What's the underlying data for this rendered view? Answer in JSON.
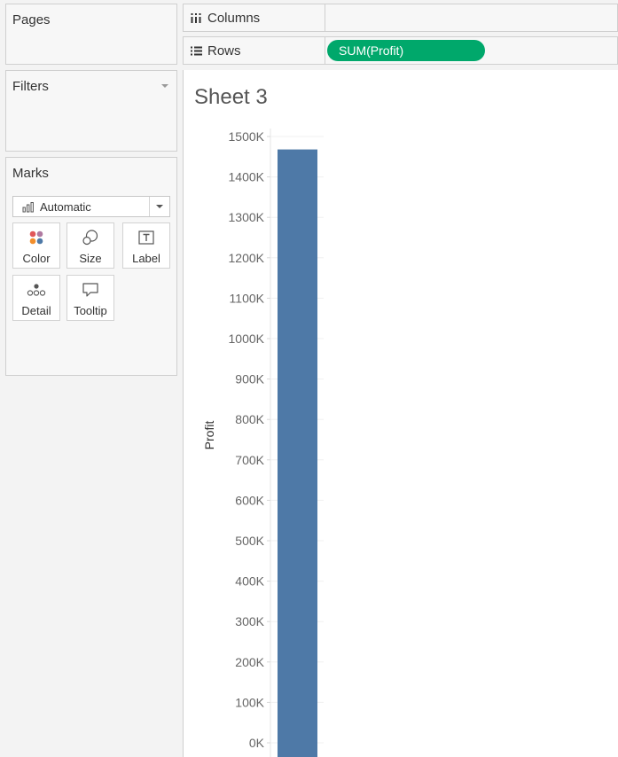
{
  "sidebar": {
    "pages_title": "Pages",
    "filters_title": "Filters",
    "marks": {
      "title": "Marks",
      "mark_type": "Automatic",
      "buttons": [
        {
          "label": "Color",
          "icon": "color-icon"
        },
        {
          "label": "Size",
          "icon": "size-icon"
        },
        {
          "label": "Label",
          "icon": "label-icon"
        },
        {
          "label": "Detail",
          "icon": "detail-icon"
        },
        {
          "label": "Tooltip",
          "icon": "tooltip-icon"
        }
      ]
    }
  },
  "shelves": {
    "columns_label": "Columns",
    "rows_label": "Rows",
    "rows_pill": "SUM(Profit)"
  },
  "sheet": {
    "title": "Sheet 3"
  },
  "colors": {
    "pill": "#00a86b",
    "bar": "#4e79a7"
  },
  "chart_data": {
    "type": "bar",
    "categories": [
      ""
    ],
    "values": [
      1468000
    ],
    "ylabel": "Profit",
    "ylim": [
      0,
      1500000
    ],
    "yticks": [
      0,
      100000,
      200000,
      300000,
      400000,
      500000,
      600000,
      700000,
      800000,
      900000,
      1000000,
      1100000,
      1200000,
      1300000,
      1400000,
      1500000
    ],
    "ytick_labels": [
      "0K",
      "100K",
      "200K",
      "300K",
      "400K",
      "500K",
      "600K",
      "700K",
      "800K",
      "900K",
      "1000K",
      "1100K",
      "1200K",
      "1300K",
      "1400K",
      "1500K"
    ],
    "grid": true
  }
}
